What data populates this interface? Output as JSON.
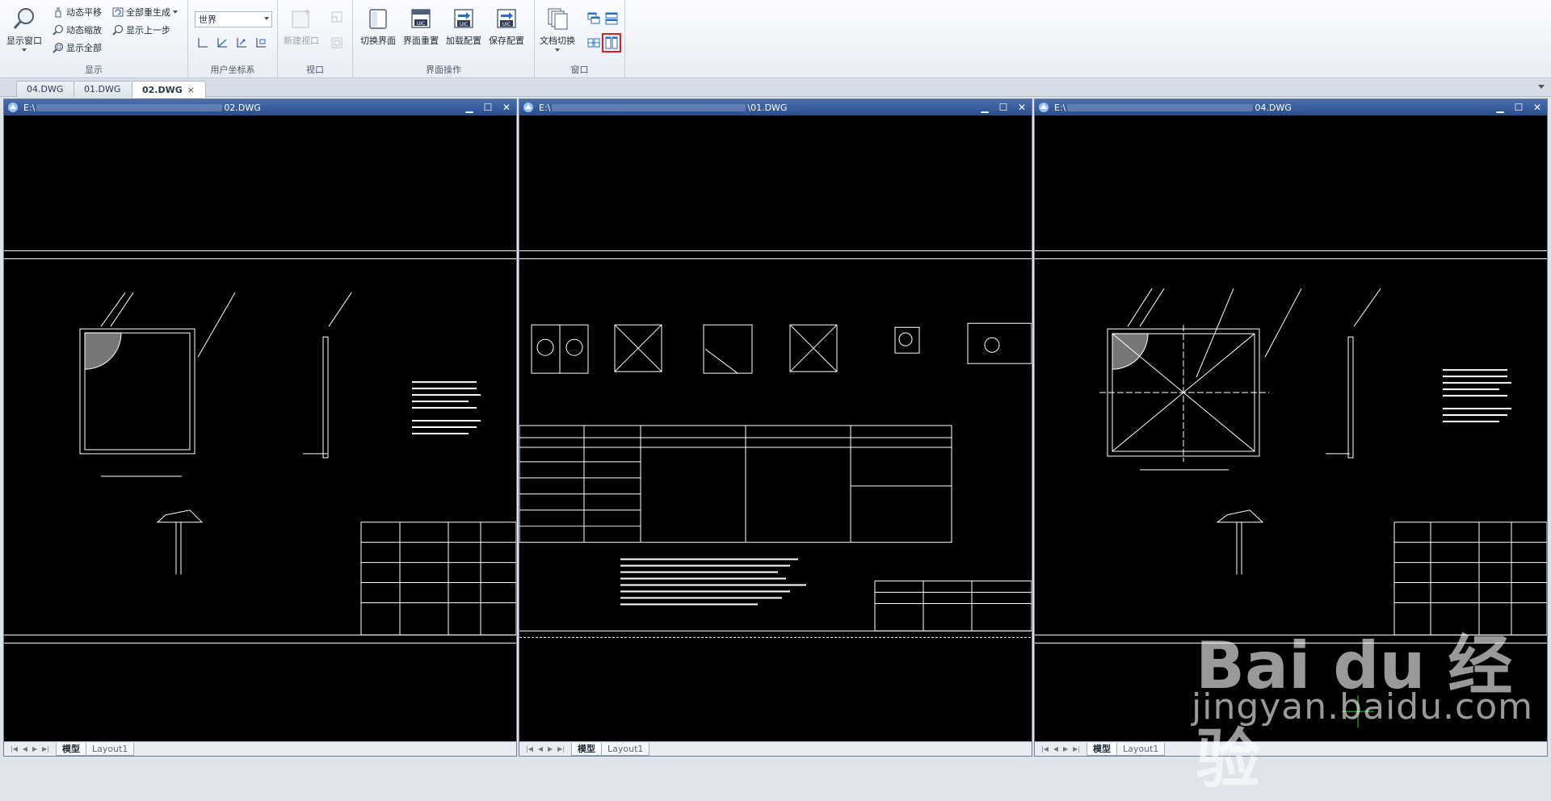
{
  "ribbon": {
    "groups": {
      "display": "显示",
      "ucs": "用户坐标系",
      "viewport": "视口",
      "ui_ops": "界面操作",
      "window": "窗口"
    },
    "display": {
      "show_window": "显示窗口",
      "dynamic_pan": "动态平移",
      "dynamic_zoom": "动态缩放",
      "show_all": "显示全部",
      "regen_all": "全部重生成",
      "show_prev": "显示上一步"
    },
    "ucs_combo_value": "世界",
    "viewport_new": "新建视口",
    "ui_ops": {
      "switch_ui": "切换界面",
      "reset_ui": "界面重置",
      "load_config": "加载配置",
      "save_config": "保存配置"
    },
    "window": {
      "doc_switch": "文档切换"
    },
    "colors": {
      "highlight": "#e11d1d"
    }
  },
  "tabs": [
    {
      "label": "04.DWG"
    },
    {
      "label": "01.DWG"
    },
    {
      "label": "02.DWG",
      "close": "×"
    }
  ],
  "windows": [
    {
      "prefix": "E:\\",
      "suffix": "02.DWG"
    },
    {
      "prefix": "E:\\",
      "suffix": "\\01.DWG"
    },
    {
      "prefix": "E:\\",
      "suffix": "04.DWG"
    }
  ],
  "window_controls": {
    "min": "▁",
    "max": "☐",
    "close": "✕"
  },
  "layout_tabs": {
    "model": "模型",
    "layout1": "Layout1"
  },
  "watermark": {
    "logo": "Bai du 经验",
    "url": "jingyan.baidu.com"
  }
}
